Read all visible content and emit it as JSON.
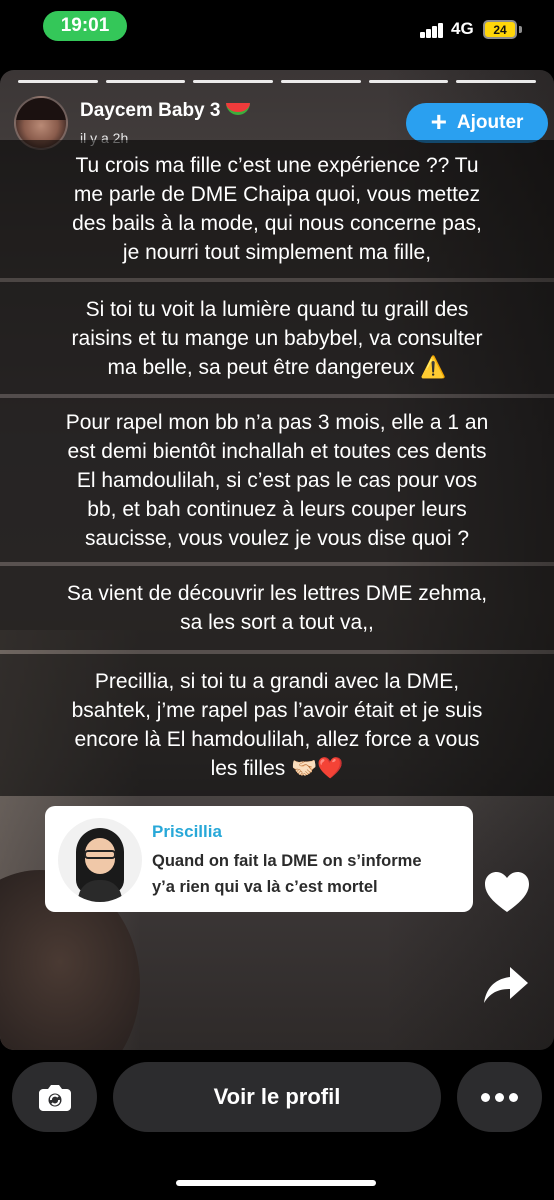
{
  "status_bar": {
    "time": "19:01",
    "network": "4G",
    "battery": "24"
  },
  "story": {
    "progress_segments": 6,
    "username": "Daycem Baby 3",
    "username_emoji": "watermelon-icon",
    "time_ago": "il y a 2h",
    "add_button_label": "Ajouter",
    "captions": [
      "Tu crois ma fille c’est une expérience ?? Tu\nme parle de DME Chaipa quoi, vous mettez\ndes bails à la mode, qui nous concerne pas,\nje nourri tout simplement ma fille,",
      "Si toi tu voit la lumière quand tu graill des\nraisins et tu mange un babybel, va consulter\nma belle, sa peut être dangereux ⚠️",
      "Pour rapel mon bb n’a pas 3 mois, elle a 1 an\nest demi bientôt inchallah et toutes ces dents\nEl hamdoulilah, si c’est pas le cas pour vos\nbb, et bah continuez à leurs couper leurs\nsaucisse, vous voulez je vous dise quoi ?",
      "Sa vient de découvrir les lettres DME zehma,\nsa les sort a tout va,,",
      "Precillia, si toi tu a grandi avec la DME,\nbsahtek, j’me rapel pas l’avoir était et je suis\nencore là El hamdoulilah, allez force a vous\nles filles 🤝🏻❤️"
    ],
    "reply": {
      "name": "Priscillia",
      "text": "Quand on fait la DME on s’informe\ny’a rien qui va là c’est mortel"
    }
  },
  "bottom_bar": {
    "profile_button_label": "Voir le profil"
  },
  "colors": {
    "time_pill": "#34c759",
    "add_button": "#2aa0f0",
    "reply_name": "#28a8d8",
    "battery": "#ffd60a"
  }
}
